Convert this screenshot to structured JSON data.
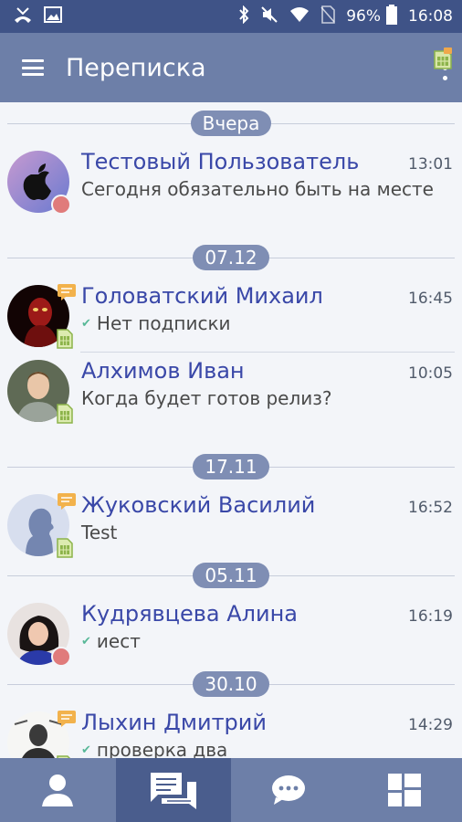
{
  "status_bar": {
    "battery": "96%",
    "time": "16:08"
  },
  "app_bar": {
    "title": "Переписка"
  },
  "colors": {
    "status_bar": "#3f5387",
    "app_bar": "#6d7fa8",
    "name_text": "#3a48a8",
    "date_pill": "#7f8eb4",
    "active_tab": "#4a5d8d"
  },
  "dates": [
    "Вчера",
    "07.12",
    "17.11",
    "05.11",
    "30.10"
  ],
  "conversations": [
    {
      "name": "Тестовый Пользователь",
      "time": "13:01",
      "preview": "Сегодня обязательно быть на месте",
      "avatar": "apple-logo-avatar",
      "read_check": false
    },
    {
      "name": "Головатский Михаил",
      "time": "16:45",
      "preview": "Нет подписки",
      "avatar": "red-figure-avatar",
      "read_check": true
    },
    {
      "name": "Алхимов Иван",
      "time": "10:05",
      "preview": "Когда будет готов релиз?",
      "avatar": "man-photo-avatar",
      "read_check": false
    },
    {
      "name": "Жуковский Василий",
      "time": "16:52",
      "preview": "Test",
      "avatar": "default-person-avatar",
      "read_check": false
    },
    {
      "name": "Кудрявцева Алина",
      "time": "16:19",
      "preview": "иест",
      "avatar": "woman-photo-avatar",
      "read_check": true
    },
    {
      "name": "Лыхин Дмитрий",
      "time": "14:29",
      "preview": "проверка два",
      "avatar": "man-drawing-avatar",
      "read_check": true
    }
  ],
  "bottom_nav": [
    {
      "icon": "person-icon",
      "active": false
    },
    {
      "icon": "messages-icon",
      "active": true
    },
    {
      "icon": "chat-bubble-icon",
      "active": false
    },
    {
      "icon": "grid-icon",
      "active": false
    }
  ]
}
